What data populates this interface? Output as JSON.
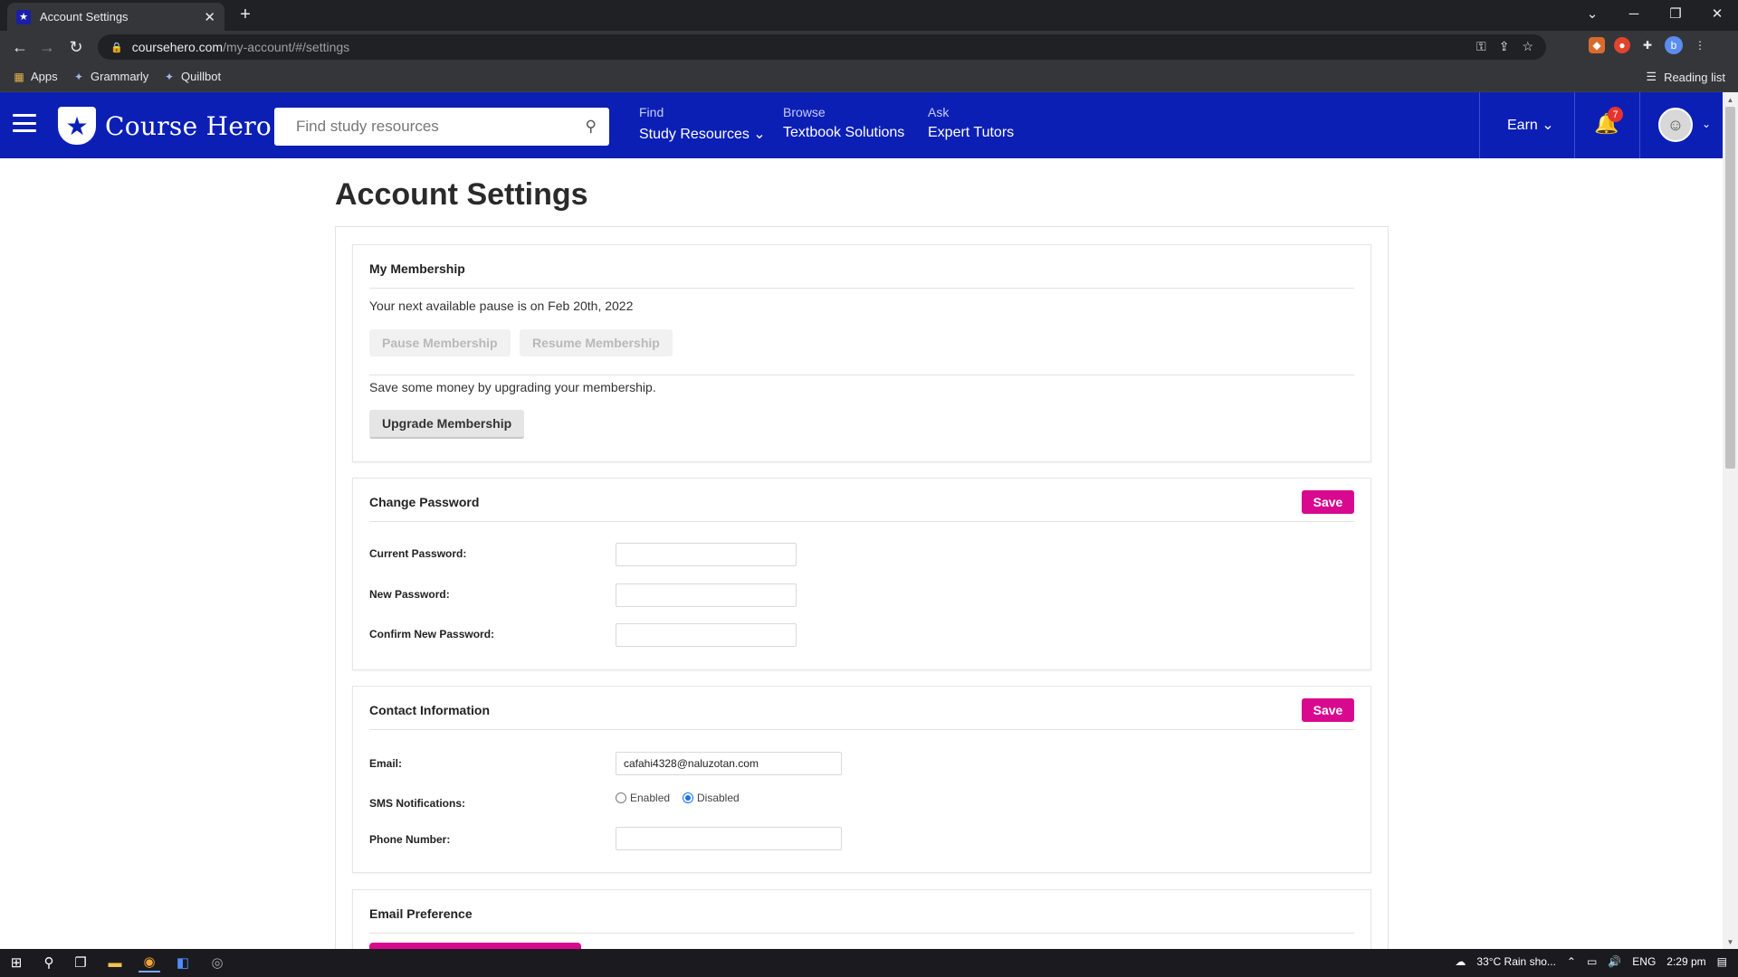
{
  "browser": {
    "tab_title": "Account Settings",
    "tab_favicon": "star-icon",
    "url_host": "coursehero.com",
    "url_path": "/my-account/#/settings",
    "bookmarks": [
      {
        "label": "Apps",
        "icon": "apps-grid-icon"
      },
      {
        "label": "Grammarly",
        "icon": "grammarly-icon"
      },
      {
        "label": "Quillbot",
        "icon": "quillbot-icon"
      }
    ],
    "reading_list": "Reading list",
    "profile_initial": "b"
  },
  "header": {
    "logo_text": "Course Hero",
    "search_placeholder": "Find study resources",
    "nav": [
      {
        "small": "Find",
        "big": "Study Resources ⌄"
      },
      {
        "small": "Browse",
        "big": "Textbook Solutions"
      },
      {
        "small": "Ask",
        "big": "Expert Tutors"
      }
    ],
    "earn": "Earn ⌄",
    "notification_count": "7",
    "brand_color": "#0c1fb5"
  },
  "page": {
    "title": "Account Settings"
  },
  "membership": {
    "title": "My Membership",
    "pause_text": "Your next available pause is on Feb 20th, 2022",
    "pause_button": "Pause Membership",
    "resume_button": "Resume Membership",
    "upgrade_text": "Save some money by upgrading your membership.",
    "upgrade_button": "Upgrade Membership"
  },
  "password": {
    "title": "Change Password",
    "save": "Save",
    "current_label": "Current Password:",
    "new_label": "New Password:",
    "confirm_label": "Confirm New Password:",
    "current_value": "",
    "new_value": "",
    "confirm_value": ""
  },
  "contact": {
    "title": "Contact Information",
    "save": "Save",
    "email_label": "Email:",
    "email_value": "cafahi4328@naluzotan.com",
    "sms_label": "SMS Notifications:",
    "sms_enabled": "Enabled",
    "sms_disabled": "Disabled",
    "sms_selected": "Disabled",
    "phone_label": "Phone Number:",
    "phone_value": "",
    "accent_color": "#d8098f"
  },
  "email_pref": {
    "title": "Email Preference"
  },
  "taskbar": {
    "weather": "33°C  Rain sho...",
    "language": "ENG",
    "time": "2:29 pm"
  }
}
